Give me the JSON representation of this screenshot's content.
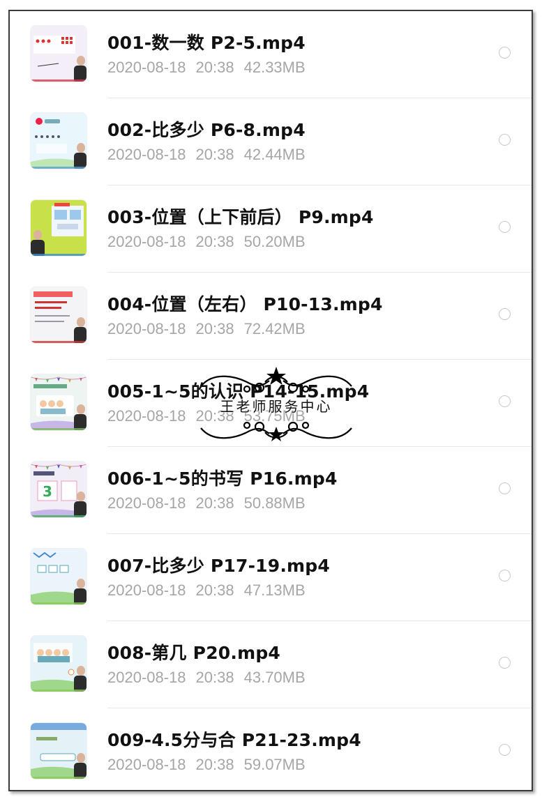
{
  "files": [
    {
      "title": "001-数一数 P2-5.mp4",
      "date": "2020-08-18",
      "time": "20:38",
      "size": "42.33MB",
      "selected": false,
      "thumb_bg": "#f3eef8",
      "thumb_accent": "#d8384a"
    },
    {
      "title": "002-比多少 P6-8.mp4",
      "date": "2020-08-18",
      "time": "20:38",
      "size": "42.44MB",
      "selected": false,
      "thumb_bg": "#e9f6fb",
      "thumb_accent": "#5aa0d8"
    },
    {
      "title": "003-位置（上下前后） P9.mp4",
      "date": "2020-08-18",
      "time": "20:38",
      "size": "50.20MB",
      "selected": false,
      "thumb_bg": "#c8e04a",
      "thumb_accent": "#3b8fd0"
    },
    {
      "title": "004-位置（左右） P10-13.mp4",
      "date": "2020-08-18",
      "time": "20:38",
      "size": "72.42MB",
      "selected": false,
      "thumb_bg": "#f4f4f6",
      "thumb_accent": "#c8383a"
    },
    {
      "title": "005-1~5的认识 P14-15.mp4",
      "date": "2020-08-18",
      "time": "20:38",
      "size": "53.75MB",
      "selected": false,
      "thumb_bg": "#eef4f1",
      "thumb_accent": "#7cb85a"
    },
    {
      "title": "006-1~5的书写 P16.mp4",
      "date": "2020-08-18",
      "time": "20:38",
      "size": "50.88MB",
      "selected": false,
      "thumb_bg": "#f1eef8",
      "thumb_accent": "#45b06a"
    },
    {
      "title": "007-比多少 P17-19.mp4",
      "date": "2020-08-18",
      "time": "20:38",
      "size": "47.13MB",
      "selected": false,
      "thumb_bg": "#eaf4fa",
      "thumb_accent": "#8ac95a"
    },
    {
      "title": "008-第几 P20.mp4",
      "date": "2020-08-18",
      "time": "20:38",
      "size": "43.70MB",
      "selected": false,
      "thumb_bg": "#e6f3f8",
      "thumb_accent": "#8ac95a"
    },
    {
      "title": "009-4.5分与合 P21-23.mp4",
      "date": "2020-08-18",
      "time": "20:38",
      "size": "59.07MB",
      "selected": false,
      "thumb_bg": "#e4f2f8",
      "thumb_accent": "#8ac95a"
    }
  ],
  "watermark": {
    "text": "王老师服务中心"
  },
  "icons": {
    "radio": "radio-unchecked-icon",
    "thumbnail": "video-thumbnail"
  },
  "colors": {
    "title": "#111111",
    "meta": "#a6a6a6",
    "divider": "#e8e8e8",
    "radio_border": "#c9c9c9"
  }
}
